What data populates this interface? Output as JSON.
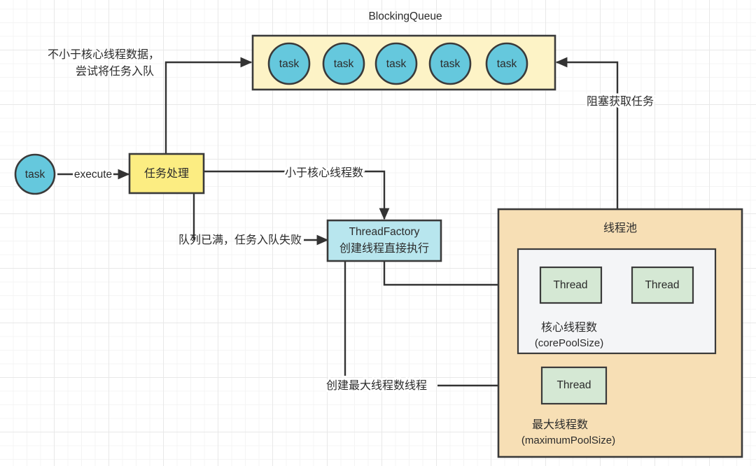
{
  "diagram": {
    "title": "BlockingQueue",
    "colors": {
      "queue_fill": "#fdf3c6",
      "task_fill": "#65c8dd",
      "process_fill": "#fced82",
      "factory_fill": "#b8e6ee",
      "pool_fill": "#f7dfb5",
      "pool_inner_fill": "#f4f5f7",
      "thread_fill": "#d5e8d4",
      "stroke": "#3a3a3a",
      "edge": "#333333",
      "text": "#2b2b2b",
      "grid_minor": "#f4f4f4",
      "grid_major": "#e8e8e8"
    },
    "queue": {
      "title": "BlockingQueue",
      "tasks": [
        {
          "label": "task"
        },
        {
          "label": "task"
        },
        {
          "label": "task"
        },
        {
          "label": "task"
        },
        {
          "label": "task"
        }
      ]
    },
    "source_task": {
      "label": "task"
    },
    "process_node": {
      "label": "任务处理"
    },
    "factory_node": {
      "line1": "ThreadFactory",
      "line2": "创建线程直接执行"
    },
    "pool": {
      "title": "线程池",
      "core": {
        "caption_line1": "核心线程数",
        "caption_line2": "(corePoolSize)",
        "threads": [
          {
            "label": "Thread"
          },
          {
            "label": "Thread"
          }
        ]
      },
      "max": {
        "caption_line1": "最大线程数",
        "caption_line2": "(maximumPoolSize)",
        "threads": [
          {
            "label": "Thread"
          }
        ]
      }
    },
    "edge_labels": {
      "execute": "execute",
      "enqueue_line1": "不小于核心线程数据，",
      "enqueue_line2": "尝试将任务入队",
      "less_than_core": "小于核心线程数",
      "queue_full": "队列已满，任务入队失败",
      "blocking_take": "阻塞获取任务",
      "create_max_threads": "创建最大线程数线程"
    }
  }
}
